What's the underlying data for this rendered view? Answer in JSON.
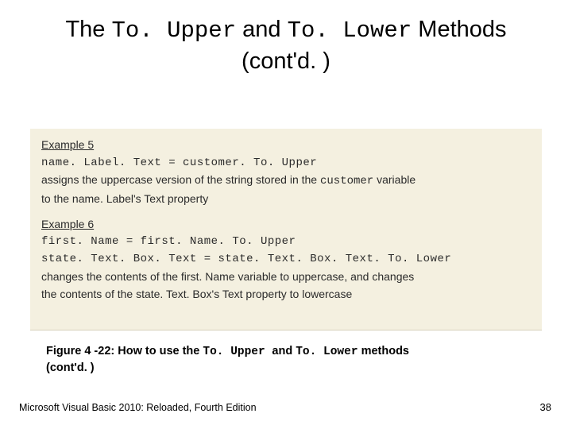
{
  "title": {
    "p1": "The ",
    "c1": "To. Upper",
    "p2": " and ",
    "c2": "To. Lower",
    "p3": " Methods",
    "line2": "(cont'd. )"
  },
  "ex5": {
    "label": "Example 5",
    "code": "name. Label. Text = customer. To. Upper",
    "desc_a": "assigns the uppercase version of the string stored in the ",
    "desc_code": "customer",
    "desc_b": " variable",
    "desc_c": "to the name. Label's Text property"
  },
  "ex6": {
    "label": "Example 6",
    "code1": "first. Name = first. Name. To. Upper",
    "code2": "state. Text. Box. Text = state. Text. Box. Text. To. Lower",
    "desc1": "changes the contents of the first. Name variable to uppercase, and changes",
    "desc2": "the contents of the state. Text. Box's Text property to lowercase"
  },
  "caption": {
    "a": "Figure 4 -22: How to use the ",
    "c1": "To. Upper ",
    "b": " and ",
    "c2": "To. Lower",
    "d": " methods",
    "line2": "(cont'd. )"
  },
  "footer": "Microsoft Visual Basic 2010: Reloaded, Fourth Edition",
  "page": "38"
}
